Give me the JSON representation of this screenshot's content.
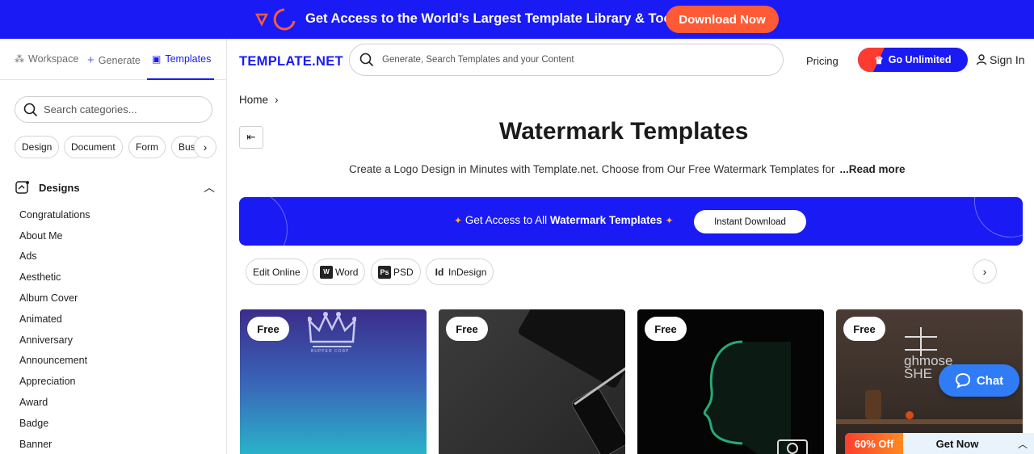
{
  "banner": {
    "text": "Get Access to the World’s Largest Template Library & Tools",
    "button": "Download Now"
  },
  "sidebar": {
    "tabs": [
      {
        "label": "Workspace",
        "icon": "workspace-icon"
      },
      {
        "label": "Generate",
        "icon": "plus-icon"
      },
      {
        "label": "Templates",
        "icon": "templates-icon",
        "active": true
      }
    ],
    "search_placeholder": "Search categories...",
    "chips": [
      "Design",
      "Document",
      "Form",
      "Bus"
    ],
    "section_title": "Designs",
    "items": [
      "Congratulations",
      "About Me",
      "Ads",
      "Aesthetic",
      "Album Cover",
      "Animated",
      "Anniversary",
      "Announcement",
      "Appreciation",
      "Award",
      "Badge",
      "Banner"
    ]
  },
  "header": {
    "logo_main": "TEMPLATE",
    "logo_suffix": ".NET",
    "search_placeholder": "Generate, Search Templates and your Content",
    "pricing": "Pricing",
    "unlimited": "Go Unlimited",
    "signin": "Sign In"
  },
  "main": {
    "breadcrumb": "Home",
    "title": "Watermark Templates",
    "description": "Create a Logo Design in Minutes with Template.net. Choose from Our Free Watermark Templates for",
    "read_more": "...Read more",
    "promo": {
      "prefix": "Get Access to All",
      "highlight": "Watermark Templates",
      "button": "Instant Download"
    },
    "formats": [
      {
        "label": "Edit Online",
        "badge": ""
      },
      {
        "label": "Word",
        "badge": "W"
      },
      {
        "label": "PSD",
        "badge": "Ps"
      },
      {
        "label": "InDesign",
        "badge": "Id"
      }
    ],
    "cards": [
      {
        "badge": "Free",
        "caption": "BUPPER CORP"
      },
      {
        "badge": "Free"
      },
      {
        "badge": "Free"
      },
      {
        "badge": "Free",
        "caption": "ghmose SHE"
      }
    ]
  },
  "chat": {
    "label": "Chat"
  },
  "offer": {
    "discount": "60% Off",
    "cta": "Get Now"
  },
  "colors": {
    "brand": "#1a1af5",
    "accent": "#ff5a36",
    "chat": "#2f7cf6"
  }
}
